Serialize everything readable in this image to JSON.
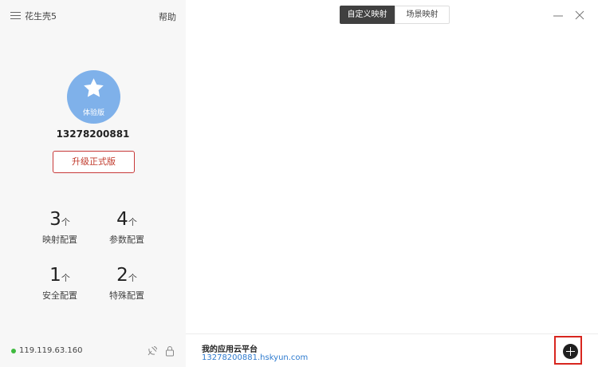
{
  "app": {
    "name": "花生壳5"
  },
  "header": {
    "help": "帮助"
  },
  "tabs": [
    {
      "label": "自定义映射",
      "active": true
    },
    {
      "label": "场景映射",
      "active": false
    }
  ],
  "profile": {
    "badge": "体验版",
    "account": "13278200881",
    "upgrade_button": "升级正式版"
  },
  "stats": [
    {
      "value": "3",
      "unit": "个",
      "label": "映射配置"
    },
    {
      "value": "4",
      "unit": "个",
      "label": "参数配置"
    },
    {
      "value": "1",
      "unit": "个",
      "label": "安全配置"
    },
    {
      "value": "2",
      "unit": "个",
      "label": "特殊配置"
    }
  ],
  "status": {
    "ip": "119.119.63.160",
    "online_color": "#3fba3f"
  },
  "bottom": {
    "title": "我的应用云平台",
    "domain": "13278200881.hskyun.com"
  },
  "icons": [
    "menu-icon",
    "star-icon",
    "satellite-icon",
    "lock-icon",
    "minimize-icon",
    "close-icon",
    "plus-icon"
  ],
  "colors": {
    "accent_red": "#c83a3a",
    "avatar_blue": "#7fb1ea",
    "link_blue": "#2e7bcf",
    "highlight_red": "#d8261f"
  }
}
